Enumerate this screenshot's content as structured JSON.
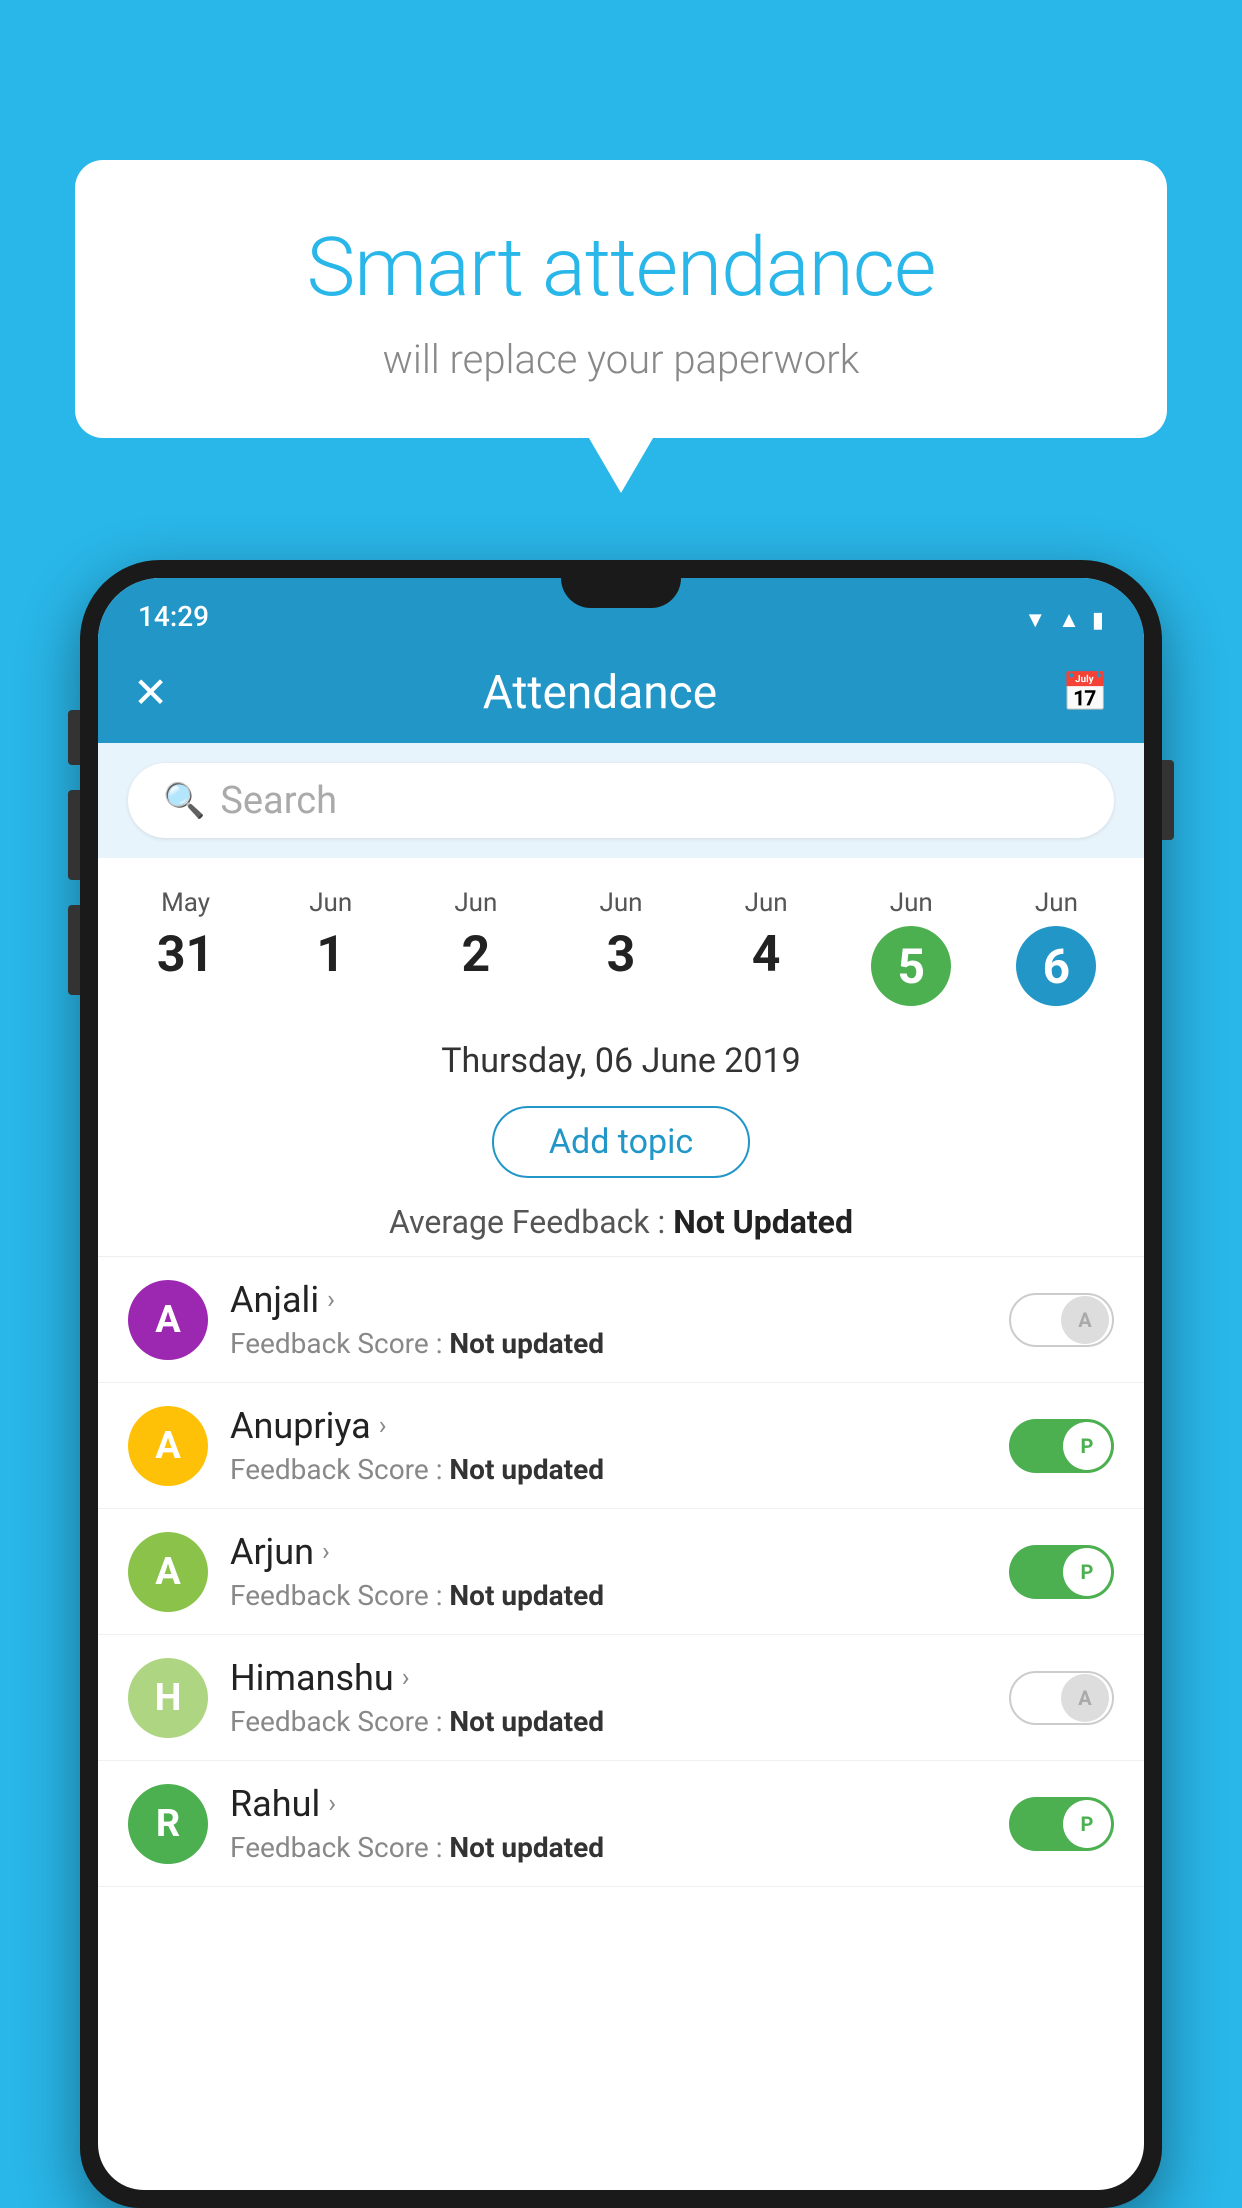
{
  "background_color": "#29b6e8",
  "bubble": {
    "title": "Smart attendance",
    "subtitle": "will replace your paperwork"
  },
  "status_bar": {
    "time": "14:29"
  },
  "app_bar": {
    "title": "Attendance",
    "close_label": "✕",
    "calendar_label": "📅"
  },
  "search": {
    "placeholder": "Search"
  },
  "dates": [
    {
      "month": "May",
      "day": "31",
      "selected": ""
    },
    {
      "month": "Jun",
      "day": "1",
      "selected": ""
    },
    {
      "month": "Jun",
      "day": "2",
      "selected": ""
    },
    {
      "month": "Jun",
      "day": "3",
      "selected": ""
    },
    {
      "month": "Jun",
      "day": "4",
      "selected": ""
    },
    {
      "month": "Jun",
      "day": "5",
      "selected": "green"
    },
    {
      "month": "Jun",
      "day": "6",
      "selected": "blue"
    }
  ],
  "date_header": "Thursday, 06 June 2019",
  "add_topic_label": "Add topic",
  "avg_feedback_label": "Average Feedback :",
  "avg_feedback_value": "Not Updated",
  "students": [
    {
      "name": "Anjali",
      "avatar_letter": "A",
      "avatar_color": "#9c27b0",
      "feedback_label": "Feedback Score :",
      "feedback_value": "Not updated",
      "toggle": "off",
      "toggle_letter": "A"
    },
    {
      "name": "Anupriya",
      "avatar_letter": "A",
      "avatar_color": "#ffc107",
      "feedback_label": "Feedback Score :",
      "feedback_value": "Not updated",
      "toggle": "on",
      "toggle_letter": "P"
    },
    {
      "name": "Arjun",
      "avatar_letter": "A",
      "avatar_color": "#8bc34a",
      "feedback_label": "Feedback Score :",
      "feedback_value": "Not updated",
      "toggle": "on",
      "toggle_letter": "P"
    },
    {
      "name": "Himanshu",
      "avatar_letter": "H",
      "avatar_color": "#aed581",
      "feedback_label": "Feedback Score :",
      "feedback_value": "Not updated",
      "toggle": "off",
      "toggle_letter": "A"
    },
    {
      "name": "Rahul",
      "avatar_letter": "R",
      "avatar_color": "#4caf50",
      "feedback_label": "Feedback Score :",
      "feedback_value": "Not updated",
      "toggle": "on",
      "toggle_letter": "P"
    }
  ]
}
